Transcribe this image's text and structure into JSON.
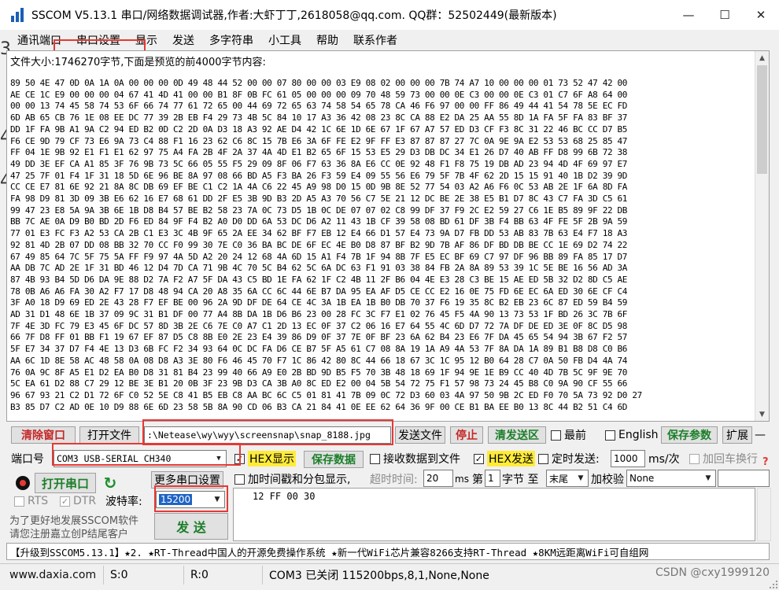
{
  "window": {
    "title": "SSCOM V5.13.1 串口/网络数据调试器,作者:大虾丁丁,2618058@qq.com. QQ群：52502449(最新版本)",
    "minimize": "—",
    "maximize": "☐",
    "close": "✕"
  },
  "ghost_digits": [
    "3",
    "4",
    "4"
  ],
  "menu": [
    "通讯端口",
    "串口设置",
    "显示",
    "发送",
    "多字符串",
    "小工具",
    "帮助",
    "联系作者"
  ],
  "viewer": {
    "info": "文件大小:1746270字节,下面是预览的前4000字节内容:",
    "hex_lines": [
      "89 50 4E 47 0D 0A 1A 0A 00 00 00 0D 49 48 44 52 00 00 07 80 00 00 03 E9 08 02 00 00 00 7B 74 A7 10 00 00 00 01 73 52 47 42 00",
      "AE CE 1C E9 00 00 00 04 67 41 4D 41 00 00 B1 8F 0B FC 61 05 00 00 00 09 70 48 59 73 00 00 0E C3 00 00 0E C3 01 C7 6F A8 64 00",
      "00 00 13 74 45 58 74 53 6F 66 74 77 61 72 65 00 44 69 72 65 63 74 58 54 65 78 CA 46 F6 97 00 00 FF 86 49 44 41 54 78 5E EC FD",
      "6D AB 65 CB 76 1E 08 EE DC 77 39 2B EB F4 29 73 4B 5C 84 10 17 A3 36 42 08 23 8C CA 88 E2 DA 25 AA 55 8D 1A FA 5F FA 83 BF 37",
      "DD 1F FA 9B A1 9A C2 94 ED B2 0D C2 2D 0A D3 18 A3 92 AE D4 42 1C 6E 1D 6E 67 1F 67 A7 57 ED D3 CF F3 8C 31 22 46 BC CC D7 B5",
      "F6 CE 9D 79 CF 73 E6 9A 73 C4 88 F1 16 23 62 C6 8C 15 7B E6 3A 6F FE E2 9F FF E3 87 87 87 27 7C 0A 9E 9A E2 53 53 68 25 85 47",
      "FF 04 1E 9B 92 E1 F1 E1 62 97 75 A4 FA 2B 4F 2A 37 4A 4D E1 B2 65 6F 15 53 E5 29 D3 DB DC 34 E1 26 D7 40 AB FF D8 99 6B 72 38",
      "49 DD 3E EF CA A1 85 3F 76 9B 73 5C 66 05 55 F5 29 09 8F 06 F7 63 36 8A E6 CC 0E 92 48 F1 F8 75 19 DB AD 23 94 4D 4F 69 97 E7",
      "47 25 7F 01 F4 1F 31 18 5D 6E 96 BE 8A 97 08 66 BD A5 F3 BA 26 F3 59 E4 09 55 56 E6 79 5F 7B 4F 62 2D 15 15 91 40 1B D2 39 9D",
      "CC CE E7 81 6E 92 21 8A 8C DB 69 EF BE C1 C2 1A 4A C6 22 45 A9 98 D0 15 0D 9B 8E 52 77 54 03 A2 A6 F6 0C 53 AB 2E 1F 6A 8D FA",
      "FA 98 D9 81 3D 09 3B E6 62 16 E7 68 61 DD 2F E5 3B 9D B3 2D A5 A3 70 56 C7 5E 21 12 DC BE 2E 38 E5 B1 D7 8C 43 C7 FA 3D C5 61",
      "99 47 23 E8 5A 9A 3B 6E 1B D8 B4 57 BE B2 58 23 7A 0C 73 D5 1B 0C DE 07 07 02 C8 99 DF 37 F9 2C E2 59 27 C6 1E B5 89 9F 22 DB",
      "BB 7C AE 0A D9 B0 BD 2D F6 ED 84 9F F4 B2 A0 D0 DD 6A 53 DC D6 A2 11 43 1B CF 39 58 08 BD 61 DF 3B F4 BB 63 4F FE 5F 2B 9A 59",
      "77 01 E3 FC F3 A2 53 CA 2B C1 E3 3C 4B 9F 65 2A EE 34 62 BF F7 EB 12 E4 66 D1 57 E4 73 9A D7 FB DD 53 AB 83 7B 63 E4 F7 18 A3",
      "92 81 4D 2B 07 DD 08 BB 32 70 CC F0 99 30 7E C0 36 BA BC DE 6F EC 4E B0 D8 87 BF B2 9D 7B AF 86 DF BD DB BE CC 1E 69 D2 74 22",
      "67 49 85 64 7C 5F 75 5A FF F9 97 4A 5D A2 20 24 12 68 4A 6D 15 A1 F4 7B 1F 94 8B 7F E5 EC BF 69 C7 97 DF 96 BB 89 FA 85 17 D7",
      "AA DB 7C AD 2E 1F 31 BD 46 12 D4 7D CA 71 9B 4C 70 5C B4 62 5C 6A DC 63 F1 91 03 38 84 FB 2A 8A 89 53 39 1C 5E BE 16 56 AD 3A",
      "87 4B 93 B4 5D D6 DA 9E 88 D2 7A F2 A7 5F DA 43 C5 BD 1E FA 62 1F C2 4B 11 2F B6 04 4E E3 28 C3 BE 15 AE ED 5B 32 D2 8D C5 AE",
      "78 0B A6 A6 FA 30 A2 F7 17 D8 48 94 CA 20 A8 35 6A CC 6C 44 6E B7 DA 95 EA AF D5 CE CC E2 16 0E 75 FD 6E EC 6A ED 30 6E CF C4",
      "3F A0 18 D9 69 ED 2E 43 28 F7 EF BE 00 96 2A 9D DF DE 64 CE 4C 3A 1B EA 1B B0 DB 70 37 F6 19 35 8C B2 EB 23 6C 87 ED 59 B4 59",
      "AD 31 D1 48 6E 1B 37 09 9C 31 B1 DF 00 77 A4 8B DA 1B D6 B6 23 00 28 FC 3C F7 E1 02 76 45 F5 4A 90 13 73 53 1F BD 26 3C 7B 6F",
      "7F 4E 3D FC 79 E3 45 6F DC 57 8D 3B 2E C6 7E C0 A7 C1 2D 13 EC 0F 37 C2 06 16 E7 64 55 4C 6D D7 72 7A DF DE ED 3E 0F 8C D5 98",
      "66 7F D8 FF 01 BB F1 19 67 EF 87 D5 C8 8B E0 2E 23 E4 39 86 D9 0F 37 7E 0F BF 23 6A 62 B4 23 E6 7F DA 45 65 54 94 3B 67 F2 57",
      "5F E7 34 37 D7 F4 4E 13 D3 6B FC F2 34 93 64 0C DC FA D6 CE B7 5F A5 61 C7 08 8A 19 1A A9 4A 53 7F 8A DA 1A 89 B1 B8 D8 C0 B6",
      "AA 6C 1D 8E 58 AC 48 58 0A 08 D8 A3 3E 80 F6 46 45 70 F7 1C 86 42 80 8C 44 66 18 67 3C 1C 95 12 B0 64 28 C7 0A 50 FB D4 4A 74",
      "76 0A 9C 8F A5 E1 D2 EA B0 D8 31 81 B4 23 99 40 66 A9 E0 2B BD 9D B5 F5 70 3B 48 18 69 1F 94 9E 1E B9 CC 40 4D 7B 5C 9F 9E 70",
      "5C EA 61 D2 88 C7 29 12 BE 3E B1 20 0B 3F 23 9B D3 CA 3B A0 8C ED E2 00 04 5B 54 72 75 F1 57 98 73 24 45 B8 C0 9A 90 CF 55 66",
      "96 67 93 21 C2 D1 72 6F C0 52 5E C8 41 B5 EB C8 AA BC 6C C5 01 81 41 7B 09 0C 72 D3 60 03 4A 97 50 9B 2C ED F0 70 5A 73 92 D0 27",
      "B3 85 D7 C2 AD 0E 10 D9 88 6E 6D 23 58 5B 8A 90 CD 06 B3 CA 21 84 41 0E EE 62 64 36 9F 00 CE B1 BA EE B0 13 8C 44 B2 51 C4 6D"
    ]
  },
  "row1": {
    "clear": "清除窗口",
    "open_file": "打开文件",
    "file_path": ":\\Netease\\wy\\wyy\\screensnap\\snap_8188.jpg",
    "send_file": "发送文件",
    "stop": "停止",
    "clear_send": "清发送区",
    "top_most": "最前",
    "english": "English",
    "save_params": "保存参数",
    "expand": "扩展",
    "dash": "—"
  },
  "row2": {
    "port_label": "端口号",
    "port_value": "COM3 USB-SERIAL CH340",
    "hex_display": "HEX显示",
    "save_data": "保存数据",
    "recv_to_file": "接收数据到文件",
    "hex_send": "HEX发送",
    "timed_send": "定时发送:",
    "interval": "1000",
    "interval_unit": "ms/次",
    "add_crlf": "加回车换行",
    "alert": "?"
  },
  "row3": {
    "open_port": "打开串口",
    "more_settings": "更多串口设置",
    "timestamp": "加时间戳和分包显示,",
    "timeout_label": "超时时间:",
    "timeout_value": "20",
    "timeout_unit": "ms",
    "nth_label": "第",
    "nth_value": "1",
    "byte_label": "字节 至",
    "end_value": "末尾",
    "checksum_label": "加校验",
    "checksum_value": "None"
  },
  "row4": {
    "rts": "RTS",
    "dtr": "DTR",
    "baud_label": "波特率:",
    "baud_value": "15200",
    "send_text": "12 FF 00 30",
    "send_button": "发 送"
  },
  "promo": {
    "line1": "为了更好地发展SSCOM软件",
    "line2": "请您注册嘉立创P结尾客户"
  },
  "ticker": "【升级到SSCOM5.13.1】★2. ★RT-Thread中国人的开源免费操作系统 ★新一代WiFi芯片兼容8266支持RT-Thread ★8KM远距离WiFi可自组网",
  "status": {
    "website": "www.daxia.com",
    "sent": "S:0",
    "received": "R:0",
    "port_state": "COM3 已关闭  115200bps,8,1,None,None",
    "watermark": "CSDN @cxy1999120"
  },
  "colors": {
    "highlight": "#e53935",
    "accent_green": "#1b7f2a",
    "hex_yellow": "#ffeb3b"
  }
}
